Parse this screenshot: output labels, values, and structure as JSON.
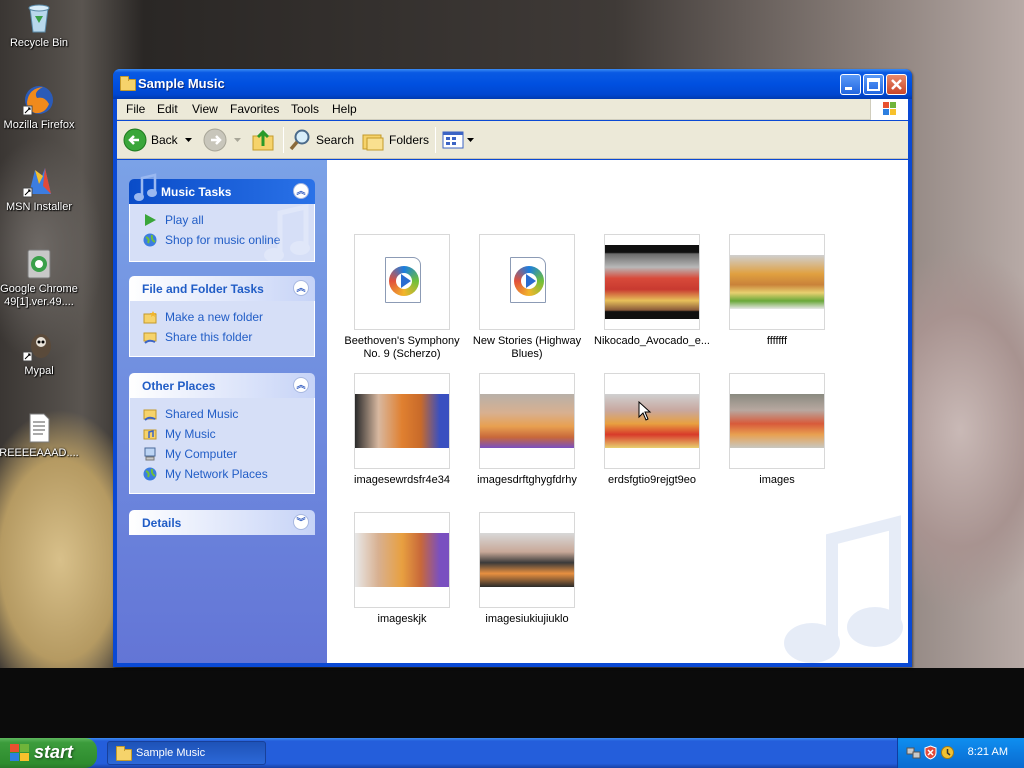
{
  "desktop": {
    "icons": [
      {
        "label": "Recycle Bin",
        "icon": "recycle-bin-icon"
      },
      {
        "label": "Mozilla Firefox",
        "icon": "firefox-icon"
      },
      {
        "label": "MSN Installer",
        "icon": "msn-icon"
      },
      {
        "label": "Google Chrome 49[1].ver.49....",
        "icon": "chrome-installer-icon"
      },
      {
        "label": "Mypal",
        "icon": "mypal-icon"
      },
      {
        "label": "REEEEAAAD....",
        "icon": "text-document-icon"
      }
    ]
  },
  "window": {
    "title": "Sample Music",
    "menu": [
      "File",
      "Edit",
      "View",
      "Favorites",
      "Tools",
      "Help"
    ],
    "toolbar": {
      "back_label": "Back",
      "search_label": "Search",
      "folders_label": "Folders"
    },
    "taskpane": {
      "music_tasks": {
        "title": "Music Tasks",
        "links": [
          "Play all",
          "Shop for music online"
        ]
      },
      "file_folder_tasks": {
        "title": "File and Folder Tasks",
        "links": [
          "Make a new folder",
          "Share this folder"
        ]
      },
      "other_places": {
        "title": "Other Places",
        "links": [
          "Shared Music",
          "My Music",
          "My Computer",
          "My Network Places"
        ]
      },
      "details": {
        "title": "Details"
      }
    },
    "files": [
      {
        "name": "Beethoven's Symphony No. 9 (Scherzo)",
        "kind": "media"
      },
      {
        "name": "New Stories (Highway Blues)",
        "kind": "media"
      },
      {
        "name": "Nikocado_Avocado_e...",
        "kind": "photo"
      },
      {
        "name": "fffffff",
        "kind": "photo"
      },
      {
        "name": "imagesewrdsfr4e34",
        "kind": "photo"
      },
      {
        "name": "imagesdrftghygfdrhy",
        "kind": "photo"
      },
      {
        "name": "erdsfgtio9rejgt9eo",
        "kind": "photo"
      },
      {
        "name": "images",
        "kind": "photo"
      },
      {
        "name": "imageskjk",
        "kind": "photo"
      },
      {
        "name": "imagesiukiujiuklo",
        "kind": "photo"
      }
    ]
  },
  "taskbar": {
    "start_label": "start",
    "active_task": "Sample Music",
    "clock": "8:21 AM"
  },
  "colors": {
    "xp_blue": "#0a49d4",
    "start_green": "#3c9c3c",
    "link_blue": "#215dc6"
  }
}
